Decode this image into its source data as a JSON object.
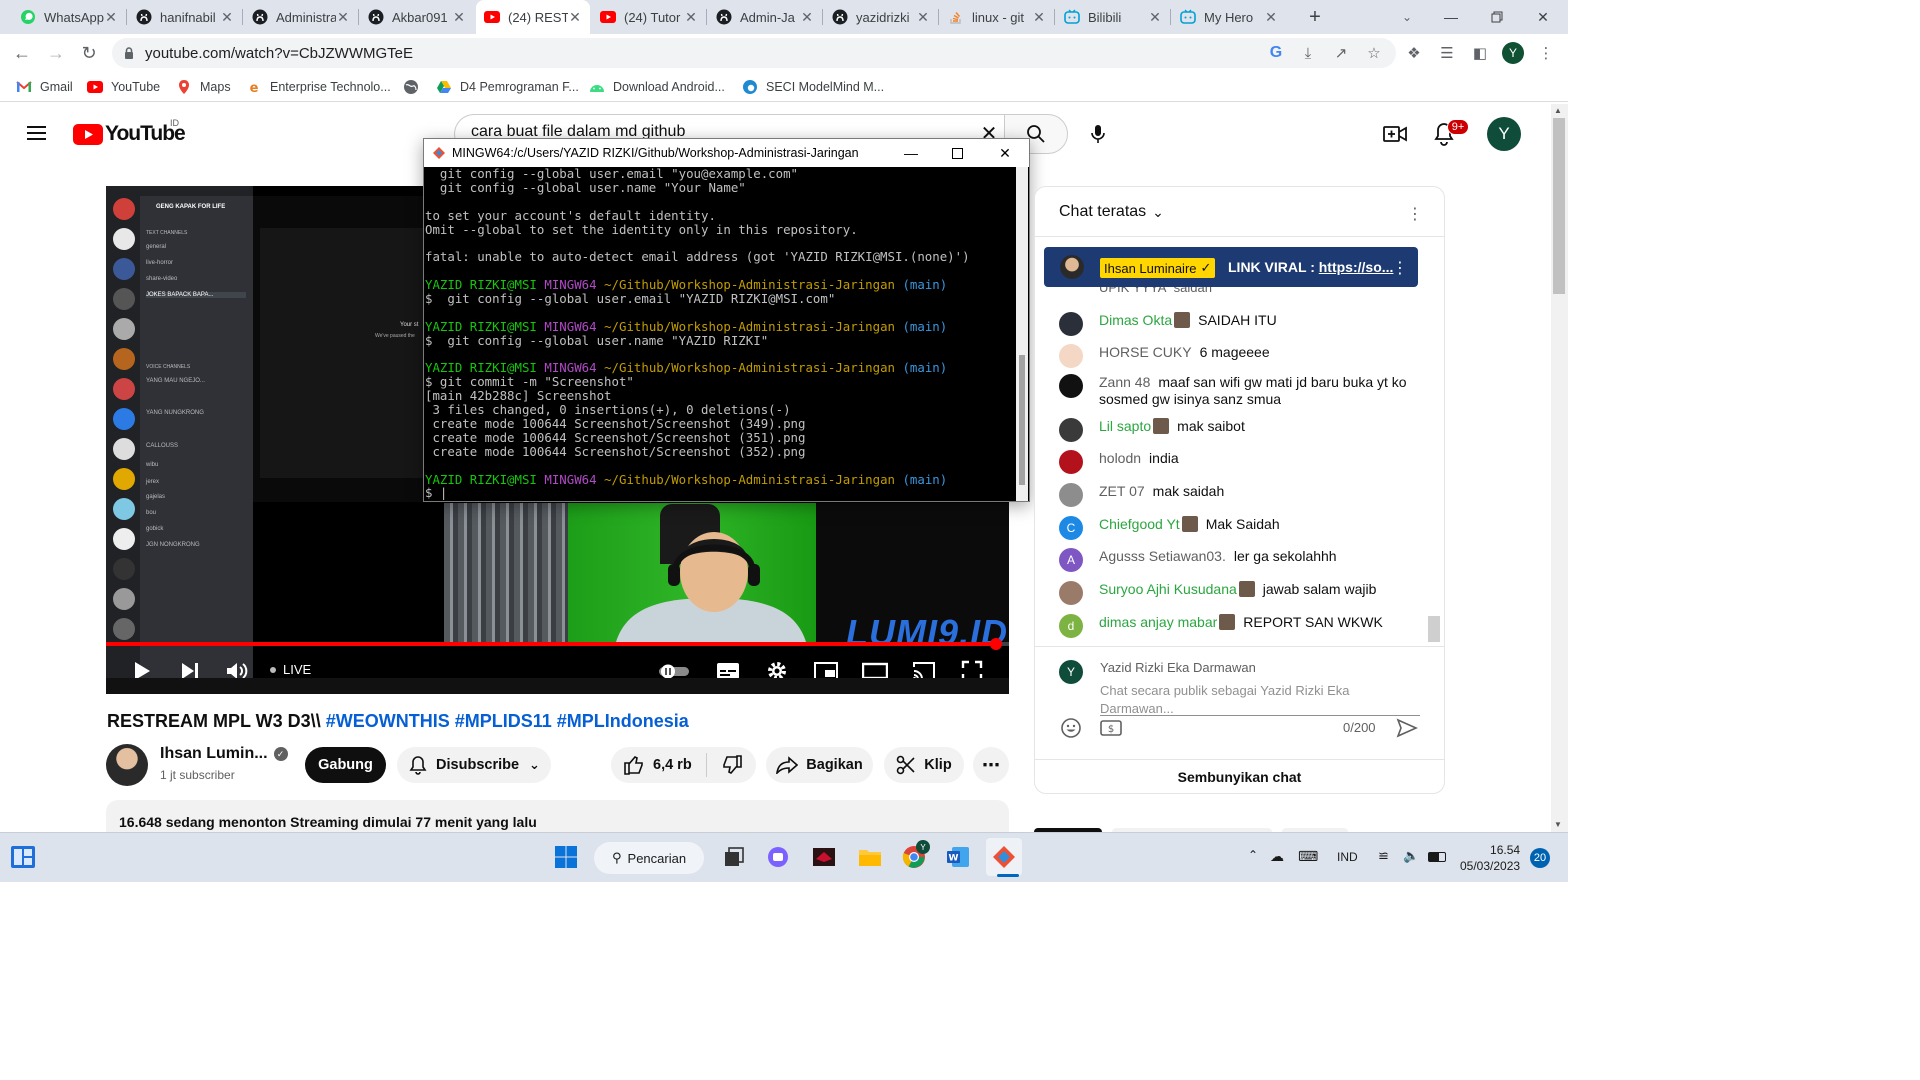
{
  "browser": {
    "tabs": [
      {
        "title": "WhatsApp",
        "icon": "whatsapp-icon",
        "active": false
      },
      {
        "title": "hanifnabil",
        "icon": "github-icon",
        "active": false
      },
      {
        "title": "Administrasi",
        "icon": "github-icon",
        "active": false
      },
      {
        "title": "Akbar091",
        "icon": "github-icon",
        "active": false
      },
      {
        "title": "(24) REST",
        "icon": "youtube-icon",
        "active": true
      },
      {
        "title": "(24) Tutor",
        "icon": "youtube-icon",
        "active": false
      },
      {
        "title": "Admin-Ja",
        "icon": "github-icon",
        "active": false
      },
      {
        "title": "yazidrizki",
        "icon": "github-icon",
        "active": false
      },
      {
        "title": "linux - git",
        "icon": "stackoverflow-icon",
        "active": false
      },
      {
        "title": "Bilibili",
        "icon": "bilibili-icon",
        "active": false
      },
      {
        "title": "My Hero",
        "icon": "bilibili-icon",
        "active": false
      }
    ],
    "url": "youtube.com/watch?v=CbJZWWMGTeE",
    "profile_initial": "Y",
    "bookmarks": [
      {
        "label": "Gmail",
        "icon": "gmail-icon"
      },
      {
        "label": "YouTube",
        "icon": "youtube-icon"
      },
      {
        "label": "Maps",
        "icon": "maps-icon"
      },
      {
        "label": "Enterprise Technolo...",
        "icon": "enterprise-icon"
      },
      {
        "label": "",
        "icon": "globe-icon"
      },
      {
        "label": "D4 Pemrograman F...",
        "icon": "drive-icon"
      },
      {
        "label": "Download Android...",
        "icon": "android-icon"
      },
      {
        "label": "SECI ModelMind M...",
        "icon": "edge-icon"
      }
    ]
  },
  "youtube": {
    "logo_text": "YouTube",
    "region": "ID",
    "search_query": "cara buat file dalam md github",
    "notification_count": "9+",
    "avatar_initial": "Y",
    "video": {
      "live_label": "LIVE",
      "watermark": "LUMI9.ID",
      "progress": 0.985,
      "discord": {
        "server_name": "GENG KAPAK FOR LIFE",
        "channels": [
          "TEXT CHANNELS",
          "general",
          "live-horror",
          "share-video",
          "JOKES BAPACK BAPA...",
          "VOICE CHANNELS",
          "YANG MAU NGEJO...",
          "YANG NUNGKRONG",
          "CALLOUSS",
          "wibu",
          "jerex",
          "gajelas",
          "bou",
          "gobick",
          "JGN NONGKRONG"
        ],
        "paused_text_1": "Your st",
        "paused_text_2": "We've paused the"
      }
    },
    "title_plain": "RESTREAM MPL W3 D3\\\\ ",
    "title_hashtags": "#WEOWNTHIS #MPLIDS11 #MPLIndonesia",
    "channel": {
      "name": "Ihsan Lumin...",
      "subscribers": "1 jt subscriber"
    },
    "buttons": {
      "join": "Gabung",
      "subscribed": "Disubscribe",
      "likes": "6,4 rb",
      "share": "Bagikan",
      "clip": "Klip"
    },
    "description": "16.648 sedang menonton  Streaming dimulai 77 menit yang lalu"
  },
  "terminal": {
    "title": "MINGW64:/c/Users/YAZID RIZKI/Github/Workshop-Administrasi-Jaringan",
    "user_host": "YAZID RIZKI@MSI",
    "shell": "MINGW64",
    "path": "~/Github/Workshop-Administrasi-Jaringan",
    "branch": "(main)",
    "lines_top": [
      "  git config --global user.email \"you@example.com\"",
      "  git config --global user.name \"Your Name\"",
      "",
      "to set your account's default identity.",
      "Omit --global to set the identity only in this repository.",
      "",
      "fatal: unable to auto-detect email address (got 'YAZID RIZKI@MSI.(none)')",
      ""
    ],
    "cmd1": "$  git config --global user.email \"YAZID RIZKI@MSI.com\"",
    "cmd2": "$  git config --global user.name \"YAZID RIZKI\"",
    "cmd3": "$ git commit -m \"Screenshot\"",
    "commit_output": [
      "[main 42b288c] Screenshot",
      " 3 files changed, 0 insertions(+), 0 deletions(-)",
      " create mode 100644 Screenshot/Screenshot (349).png",
      " create mode 100644 Screenshot/Screenshot (351).png",
      " create mode 100644 Screenshot/Screenshot (352).png"
    ],
    "prompt_end": "$ |"
  },
  "chat": {
    "header": "Chat teratas",
    "pinned": {
      "author": "Ihsan Luminaire",
      "text_plain": "LINK VIRAL : ",
      "link": "https://so..."
    },
    "partial_row": {
      "author": "UPIK YYYA",
      "text": "saidah"
    },
    "messages": [
      {
        "author": "Dimas Okta",
        "text": "SAIDAH ITU",
        "member": true,
        "avatar_color": "#2a2f3a"
      },
      {
        "author": "HORSE CUKY",
        "text": "6 mageeee",
        "member": false,
        "avatar_color": "#f4d7c4"
      },
      {
        "author": "Zann 48",
        "text": "maaf san wifi gw mati jd baru buka yt ko sosmed gw isinya sanz smua",
        "member": false,
        "avatar_color": "#111111"
      },
      {
        "author": "Lil sapto",
        "text": "mak saibot",
        "member": true,
        "avatar_color": "#3a3a3a"
      },
      {
        "author": "holodn",
        "text": "india",
        "member": false,
        "avatar_color": "#b3121d"
      },
      {
        "author": "ZET 07",
        "text": "mak saidah",
        "member": false,
        "avatar_color": "#8d8d8d"
      },
      {
        "author": "Chiefgood Yt",
        "text": "Mak Saidah",
        "member": true,
        "avatar_color": "#1e88e5",
        "initial": "C"
      },
      {
        "author": "Agusss Setiawan03.",
        "text": "ler ga sekolahhh",
        "member": false,
        "avatar_color": "#7e57c2",
        "initial": "A"
      },
      {
        "author": "Suryoo Ajhi Kusudana",
        "text": "jawab salam wajib",
        "member": true,
        "avatar_color": "#9a7b6a"
      },
      {
        "author": "dimas anjay mabar",
        "text": "REPORT SAN WKWK",
        "member": true,
        "avatar_color": "#7cb342",
        "initial": "d"
      }
    ],
    "input_user": "Yazid Rizki Eka Darmawan",
    "input_user_initial": "Y",
    "input_placeholder": "Chat secara publik sebagai Yazid Rizki Eka Darmawan...",
    "char_count": "0/200",
    "hide_chat": "Sembunyikan chat"
  },
  "taskbar": {
    "search_label": "Pencarian",
    "language": "IND",
    "time": "16.54",
    "date": "05/03/2023",
    "notification_count": "20"
  }
}
